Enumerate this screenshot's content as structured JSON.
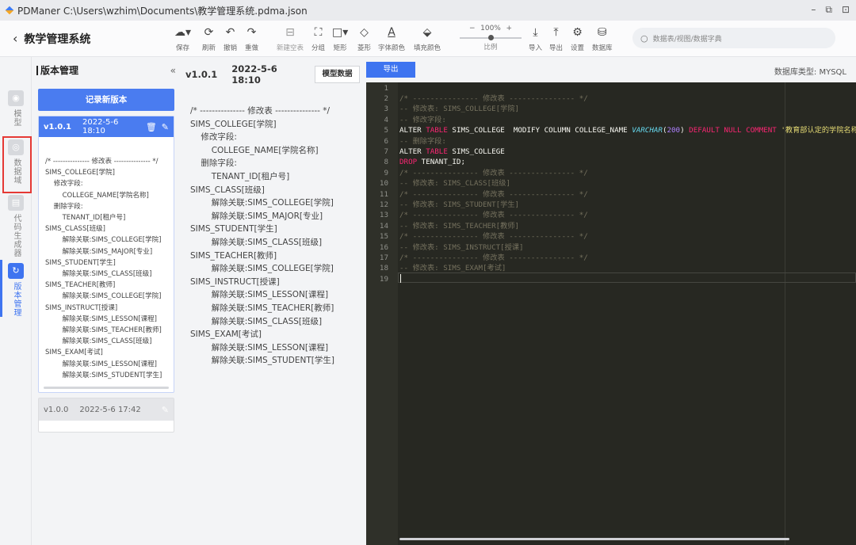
{
  "window": {
    "title": "PDManer  C:\\Users\\wzhim\\Documents\\教学管理系统.pdma.json",
    "controls": [
      "–",
      "⧉",
      "⊡"
    ]
  },
  "header": {
    "back_icon": "chevron-left-icon",
    "project": "教学管理系统"
  },
  "toolbar": {
    "save": "保存",
    "refresh": "刷新",
    "undo": "撤销",
    "redo": "重做",
    "new_blank": "新建空表",
    "group": "分组",
    "rect": "矩形",
    "diamond": "菱形",
    "font_color": "字体颜色",
    "fill_color": "填充颜色",
    "zoom_value": "100%",
    "zoom_minus": "−",
    "zoom_plus": "+",
    "zoom_label": "比例",
    "zoom_level": 0.5,
    "import": "导入",
    "export": "导出",
    "settings": "设置",
    "database": "数据库"
  },
  "search": {
    "placeholder": "数据表/视图/数据字典"
  },
  "rail": {
    "items": [
      {
        "label": "模型",
        "active": false
      },
      {
        "label": "数据域",
        "active": false
      },
      {
        "label": "代码生成器",
        "active": false
      },
      {
        "label": "版本管理",
        "active": true
      }
    ]
  },
  "version_panel": {
    "title": "版本管理",
    "collapse": "«",
    "record_button": "记录新版本",
    "versions": [
      {
        "version": "v1.0.1",
        "date": "2022-5-6 18:10",
        "active": true,
        "summary": "/* --------------- 修改表 --------------- */\nSIMS_COLLEGE[学院]\n    修改字段:\n        COLLEGE_NAME[学院名称]\n    删除字段:\n        TENANT_ID[租户号]\nSIMS_CLASS[班级]\n        解除关联:SIMS_COLLEGE[学院]\n        解除关联:SIMS_MAJOR[专业]\nSIMS_STUDENT[学生]\n        解除关联:SIMS_CLASS[班级]\nSIMS_TEACHER[教师]\n        解除关联:SIMS_COLLEGE[学院]\nSIMS_INSTRUCT[授课]\n        解除关联:SIMS_LESSON[课程]\n        解除关联:SIMS_TEACHER[教师]\n        解除关联:SIMS_CLASS[班级]\nSIMS_EXAM[考试]\n        解除关联:SIMS_LESSON[课程]\n        解除关联:SIMS_STUDENT[学生]"
      },
      {
        "version": "v1.0.0",
        "date": "2022-5-6 17:42",
        "active": false
      }
    ]
  },
  "detail": {
    "version": "v1.0.1",
    "date": "2022-5-6 18:10",
    "model_button": "模型数据",
    "summary": "/* --------------- 修改表 --------------- */\nSIMS_COLLEGE[学院]\n    修改字段:\n        COLLEGE_NAME[学院名称]\n    删除字段:\n        TENANT_ID[租户号]\nSIMS_CLASS[班级]\n        解除关联:SIMS_COLLEGE[学院]\n        解除关联:SIMS_MAJOR[专业]\nSIMS_STUDENT[学生]\n        解除关联:SIMS_CLASS[班级]\nSIMS_TEACHER[教师]\n        解除关联:SIMS_COLLEGE[学院]\nSIMS_INSTRUCT[授课]\n        解除关联:SIMS_LESSON[课程]\n        解除关联:SIMS_TEACHER[教师]\n        解除关联:SIMS_CLASS[班级]\nSIMS_EXAM[考试]\n        解除关联:SIMS_LESSON[课程]\n        解除关联:SIMS_STUDENT[学生]"
  },
  "editor": {
    "export_button": "导出",
    "db_type": "数据库类型: MYSQL",
    "lines": [
      [],
      [
        {
          "c": "c",
          "t": "/* --------------- 修改表 --------------- */"
        }
      ],
      [
        {
          "c": "c",
          "t": "-- 修改表: SIMS_COLLEGE[学院]"
        }
      ],
      [
        {
          "c": "c",
          "t": "-- 修改字段:"
        }
      ],
      [
        {
          "c": "w",
          "t": "ALTER "
        },
        {
          "c": "k",
          "t": "TABLE"
        },
        {
          "c": "w",
          "t": " SIMS_COLLEGE  MODIFY COLUMN COLLEGE_NAME "
        },
        {
          "c": "t",
          "t": "VARCHAR"
        },
        {
          "c": "w",
          "t": "("
        },
        {
          "c": "n",
          "t": "200"
        },
        {
          "c": "w",
          "t": ") "
        },
        {
          "c": "k",
          "t": "DEFAULT NULL"
        },
        {
          "c": "w",
          "t": " "
        },
        {
          "c": "k",
          "t": "COMMENT"
        },
        {
          "c": "w",
          "t": " "
        },
        {
          "c": "s",
          "t": "'教育部认定的学院名称'"
        }
      ],
      [
        {
          "c": "c",
          "t": "-- 删除字段:"
        }
      ],
      [
        {
          "c": "w",
          "t": "ALTER "
        },
        {
          "c": "k",
          "t": "TABLE"
        },
        {
          "c": "w",
          "t": " SIMS_COLLEGE"
        }
      ],
      [
        {
          "c": "k",
          "t": "DROP"
        },
        {
          "c": "w",
          "t": " TENANT_ID;"
        }
      ],
      [
        {
          "c": "c",
          "t": "/* --------------- 修改表 --------------- */"
        }
      ],
      [
        {
          "c": "c",
          "t": "-- 修改表: SIMS_CLASS[班级]"
        }
      ],
      [
        {
          "c": "c",
          "t": "/* --------------- 修改表 --------------- */"
        }
      ],
      [
        {
          "c": "c",
          "t": "-- 修改表: SIMS_STUDENT[学生]"
        }
      ],
      [
        {
          "c": "c",
          "t": "/* --------------- 修改表 --------------- */"
        }
      ],
      [
        {
          "c": "c",
          "t": "-- 修改表: SIMS_TEACHER[教师]"
        }
      ],
      [
        {
          "c": "c",
          "t": "/* --------------- 修改表 --------------- */"
        }
      ],
      [
        {
          "c": "c",
          "t": "-- 修改表: SIMS_INSTRUCT[授课]"
        }
      ],
      [
        {
          "c": "c",
          "t": "/* --------------- 修改表 --------------- */"
        }
      ],
      [
        {
          "c": "c",
          "t": "-- 修改表: SIMS_EXAM[考试]"
        }
      ],
      []
    ]
  }
}
